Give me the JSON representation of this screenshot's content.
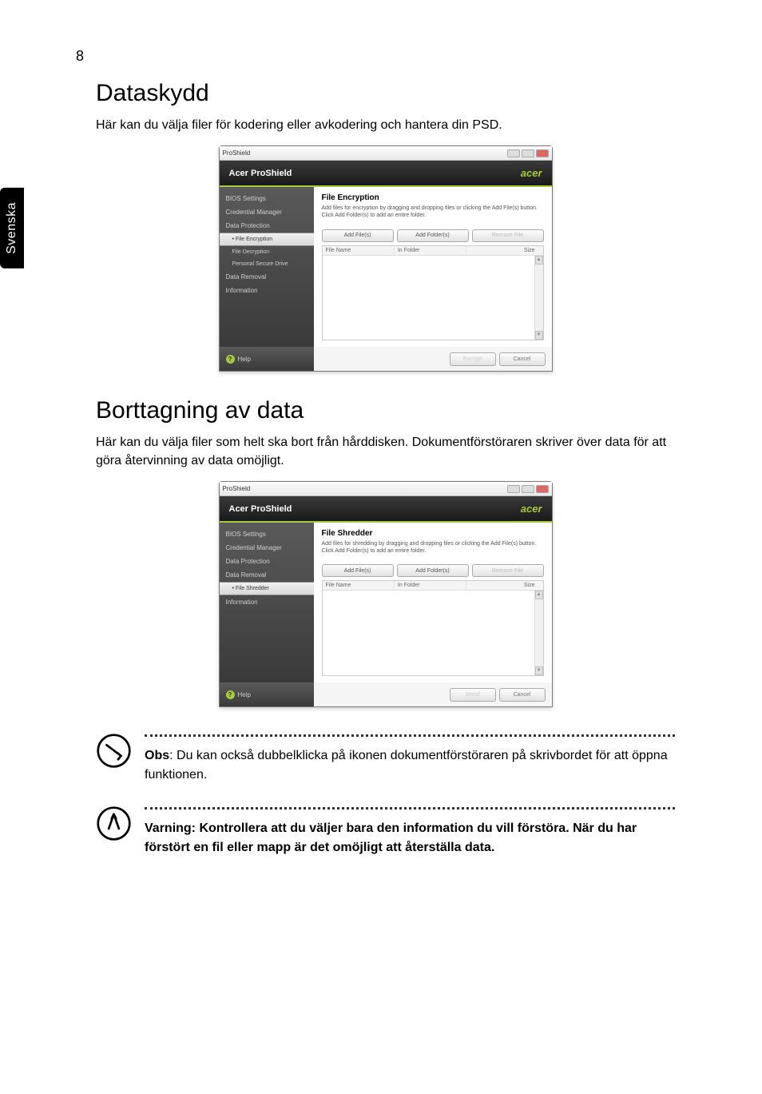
{
  "page_number": "8",
  "language_tab": "Svenska",
  "section1": {
    "heading": "Dataskydd",
    "intro": "Här kan du välja filer för kodering eller avkodering och hantera din PSD."
  },
  "section2": {
    "heading": "Borttagning av data",
    "intro": "Här kan du välja filer som helt ska bort från hårddisken. Dokumentförstöraren skriver över data för att göra återvinning av data omöjligt."
  },
  "window_common": {
    "titlebar": "ProShield",
    "header_title": "Acer ProShield",
    "brand": "acer",
    "help_label": "Help",
    "buttons": {
      "add_files": "Add File(s)",
      "add_folders": "Add Folder(s)",
      "remove_file": "Remove File"
    },
    "columns": {
      "filename": "File Name",
      "infolder": "In Folder",
      "size": "Size"
    },
    "cancel": "Cancel"
  },
  "window1": {
    "panel_title": "File Encryption",
    "panel_desc": "Add files for encryption by dragging and dropping files or clicking the Add File(s) button. Click Add Folder(s) to add an entire folder.",
    "primary_action": "Encrypt",
    "sidebar": [
      {
        "label": "BIOS Settings",
        "active": false
      },
      {
        "label": "Credential Manager",
        "active": false
      },
      {
        "label": "Data Protection",
        "active": false
      },
      {
        "label": "• File Encryption",
        "sub": true,
        "active": true
      },
      {
        "label": "File Decryption",
        "sub": true,
        "active": false
      },
      {
        "label": "Personal Secure Drive",
        "sub": true,
        "active": false
      },
      {
        "label": "Data Removal",
        "active": false
      },
      {
        "label": "Information",
        "active": false
      }
    ]
  },
  "window2": {
    "panel_title": "File Shredder",
    "panel_desc": "Add files for shredding by dragging and dropping files or clicking the Add File(s) button. Click Add Folder(s) to add an entire folder.",
    "primary_action": "Shred",
    "sidebar": [
      {
        "label": "BIOS Settings",
        "active": false
      },
      {
        "label": "Credential Manager",
        "active": false
      },
      {
        "label": "Data Protection",
        "active": false
      },
      {
        "label": "Data Removal",
        "active": false
      },
      {
        "label": "• File Shredder",
        "sub": true,
        "active": true
      },
      {
        "label": "Information",
        "active": false
      }
    ]
  },
  "note": {
    "label": "Obs",
    "text": ": Du kan också dubbelklicka på ikonen dokumentförstöraren på skrivbordet för att öppna funktionen."
  },
  "warning": {
    "text": "Varning: Kontrollera att du väljer bara den information du vill förstöra. När du har förstört en fil eller mapp är det omöjligt att återställa data."
  }
}
